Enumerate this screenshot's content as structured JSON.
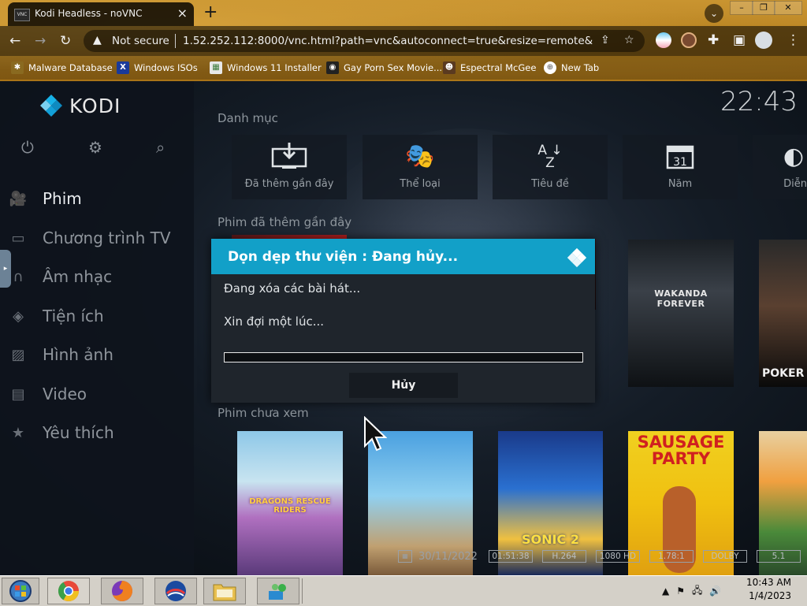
{
  "browser": {
    "tab_title": "Kodi Headless - noVNC",
    "tab_favicon": "VNC",
    "new_tab_icon": "+",
    "security_label": "Not secure",
    "url": "1.52.252.112:8000/vnc.html?path=vnc&autoconnect=true&resize=remote&rec...",
    "bookmarks": [
      {
        "label": "Malware Database",
        "icon": "bug-icon"
      },
      {
        "label": "Windows ISOs",
        "icon": "x-icon"
      },
      {
        "label": "Windows 11 Installer",
        "icon": "image-icon"
      },
      {
        "label": "Gay Porn Sex Movie...",
        "icon": "site-icon"
      },
      {
        "label": "Espectral McGee",
        "icon": "avatar-icon"
      },
      {
        "label": "New Tab",
        "icon": "globe-icon"
      }
    ]
  },
  "kodi": {
    "logo_text": "KODI",
    "clock": "22:43",
    "menu": [
      {
        "label": "Phim",
        "icon": "film-camera-icon"
      },
      {
        "label": "Chương trình TV",
        "icon": "tv-icon"
      },
      {
        "label": "Âm nhạc",
        "icon": "headphones-icon"
      },
      {
        "label": "Tiện ích",
        "icon": "addons-box-icon"
      },
      {
        "label": "Hình ảnh",
        "icon": "picture-icon"
      },
      {
        "label": "Video",
        "icon": "video-icon"
      },
      {
        "label": "Yêu thích",
        "icon": "star-icon"
      }
    ],
    "section_categories": "Danh mục",
    "categories": [
      {
        "label": "Đã thêm gần đây",
        "icon": "download-tray-icon"
      },
      {
        "label": "Thể loại",
        "icon": "theater-masks-icon"
      },
      {
        "label": "Tiêu đề",
        "icon": "sort-az-icon"
      },
      {
        "label": "Năm",
        "icon": "calendar-31-icon"
      },
      {
        "label": "Diễn",
        "icon": "actors-icon"
      }
    ],
    "section_recent": "Phim đã thêm gần đây",
    "section_unwatched": "Phim chưa xem",
    "recent_posters": [
      {
        "title": "WAKANDA FOREVER"
      },
      {
        "title": "POKER"
      }
    ],
    "unwatched_posters": [
      {
        "title": "DRAGONS RESCUE RIDERS"
      },
      {
        "title": ""
      },
      {
        "title": "SONIC 2"
      },
      {
        "title": "SAUSAGE PARTY"
      },
      {
        "title": ""
      }
    ],
    "info": {
      "date": "30/11/2022",
      "badges": [
        "01:51:38",
        "H.264",
        "1080 HD",
        "1.78:1",
        "DOLBY",
        "5.1"
      ]
    },
    "dialog": {
      "title": "Dọn dẹp thư viện : Đang hủy...",
      "line1": "Đang xóa các bài hát...",
      "line2": "Xin đợi một lúc...",
      "progress": 0,
      "cancel_label": "Hủy"
    }
  },
  "taskbar": {
    "time": "10:43 AM",
    "date": "1/4/2023"
  },
  "colors": {
    "kodi_accent": "#12a0c8",
    "browser_frame": "#c99430"
  }
}
